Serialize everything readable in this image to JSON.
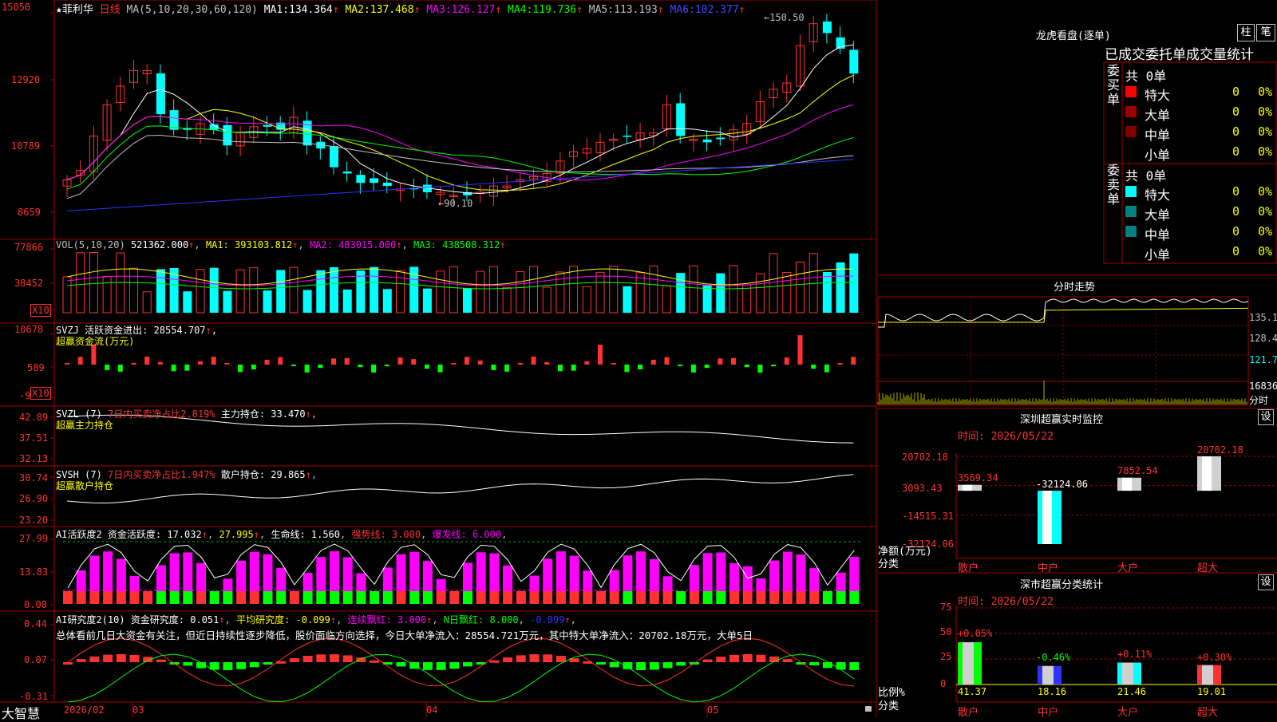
{
  "colors": {
    "up": "#ff3232",
    "down": "#00ffff",
    "grid": "#a00000",
    "ma1": "#ffffff",
    "ma2": "#ffff00",
    "ma3": "#ff00ff",
    "ma4": "#00ff00",
    "ma5": "#c0c0c0",
    "ma6": "#3232ff"
  },
  "stock": {
    "name": "菲利华",
    "star": "★",
    "period": "日线",
    "ma_params": "MA(5,10,20,30,60,120)"
  },
  "main_chart": {
    "ma_values": [
      {
        "label": "MA1:",
        "value": "134.364"
      },
      {
        "label": "MA2:",
        "value": "137.468"
      },
      {
        "label": "MA3:",
        "value": "126.127"
      },
      {
        "label": "MA4:",
        "value": "119.736"
      },
      {
        "label": "MA5:",
        "value": "113.193"
      },
      {
        "label": "MA6:",
        "value": "102.377"
      }
    ],
    "yticks": [
      "15050",
      "12920",
      "10789",
      "8659"
    ],
    "high_label": "150.50",
    "low_label": "90.10"
  },
  "vol": {
    "params": "VOL(5,10,20)",
    "value": "521362.000",
    "ma1": "MA1: 393103.812",
    "ma2": "MA2: 483015.000",
    "ma3": "MA3: 438508.312",
    "yticks": [
      "77866",
      "38452"
    ],
    "unit": "X10"
  },
  "svzj": {
    "header": "SVZJ  活跃资金进出: 28554.707",
    "subtitle": "超赢资金流(万元)",
    "yticks": [
      "10678",
      "589",
      "-9"
    ],
    "unit": "X10"
  },
  "svzl": {
    "header_a": "SVZL (7) ",
    "header_b": "7日内买卖净占比2.819%",
    "header_c": " 主力持仓: 33.470",
    "subtitle": "超赢主力持仓",
    "yticks": [
      "42.89",
      "37.51",
      "32.13"
    ]
  },
  "svsh": {
    "header_a": "SVSH (7) ",
    "header_b": "7日内买卖净占比1.947%",
    "header_c": " 散户持仓: 29.865",
    "subtitle": "超赢散户持仓",
    "yticks": [
      "30.74",
      "26.90",
      "23.20"
    ]
  },
  "ai_active": {
    "header": "AI活跃度2 资金活跃度: 17.032",
    "v2": "27.995",
    "v3": "生命线: 1.560",
    "v4": "强势线: 3.000",
    "v5": "爆发线: 6.000",
    "yticks": [
      "27.99",
      "13.83",
      "0.00"
    ]
  },
  "ai_research": {
    "header": "AI研究度2(10) 资金研究度: 0.051",
    "v2": "平均研究度: -0.099",
    "v3": "连续飘红: 3.000",
    "v4": "N日飘红: 8.000",
    "v5": "-0.099",
    "commentary": "总体看前几日大资金有关注，但近日持续性逐步降低，股价面临方向选择，今日大单净流入：28554.721万元，其中特大单净流入：20702.18万元，大单5日",
    "yticks": [
      "0.44",
      "0.07",
      "-0.31"
    ]
  },
  "xaxis": {
    "brand": "大智慧",
    "labels": [
      "2026/02",
      "03",
      "04",
      "05"
    ]
  },
  "dragon": {
    "title": "龙虎看盘(逐单)",
    "btn1": "柱",
    "btn2": "笔",
    "tab1": "已成交",
    "tab2": "委托单",
    "tab3": "成交量统计",
    "buy_side": "委买单",
    "sell_side": "委卖单",
    "total_buy": "共 0单",
    "total_sell": "共 0单",
    "rows_buy": [
      {
        "label": "特大",
        "count": "0",
        "pct": "0%",
        "color": "#ff0000"
      },
      {
        "label": "大单",
        "count": "0",
        "pct": "0%",
        "color": "#a00000"
      },
      {
        "label": "中单",
        "count": "0",
        "pct": "0%",
        "color": "#800000"
      },
      {
        "label": "小单",
        "count": "0",
        "pct": "0%",
        "color": "#000000"
      }
    ],
    "rows_sell": [
      {
        "label": "特大",
        "count": "0",
        "pct": "0%",
        "color": "#00ffff"
      },
      {
        "label": "大单",
        "count": "0",
        "pct": "0%",
        "color": "#008080"
      },
      {
        "label": "中单",
        "count": "0",
        "pct": "0%",
        "color": "#008080"
      },
      {
        "label": "小单",
        "count": "0",
        "pct": "0%",
        "color": "#000000"
      }
    ]
  },
  "intraday": {
    "title": "分时走势",
    "yticks": [
      "135.1",
      "128.4",
      "121.7"
    ],
    "vol_label": "16836",
    "period": "分时"
  },
  "monitor": {
    "title": "深圳超赢实时监控",
    "btn": "设",
    "time": "时间: 2026/05/22",
    "yticks": [
      "20702.18",
      "3093.43",
      "-14515.31",
      "-32124.06"
    ],
    "ylabel": "净额(万元)",
    "xlabel": "分类",
    "categories": [
      "散户",
      "中户",
      "大户",
      "超大"
    ],
    "values": [
      3569.34,
      -32124.06,
      7852.54,
      20702.18
    ],
    "labels": [
      "3569.34",
      "-32124.06",
      "7852.54",
      "20702.18"
    ]
  },
  "classify": {
    "title": "深市超赢分类统计",
    "btn": "设",
    "time": "时间: 2026/05/22",
    "yticks": [
      "75",
      "50",
      "25",
      "0"
    ],
    "ylabel": "比例%",
    "xlabel": "分类",
    "categories": [
      "散户",
      "中户",
      "大户",
      "超大"
    ],
    "values": [
      41.37,
      18.16,
      21.46,
      19.01
    ],
    "changes": [
      "+0.05%",
      "-0.46%",
      "+0.11%",
      "+0.30%"
    ],
    "labels": [
      "41.37",
      "18.16",
      "21.46",
      "19.01"
    ]
  }
}
